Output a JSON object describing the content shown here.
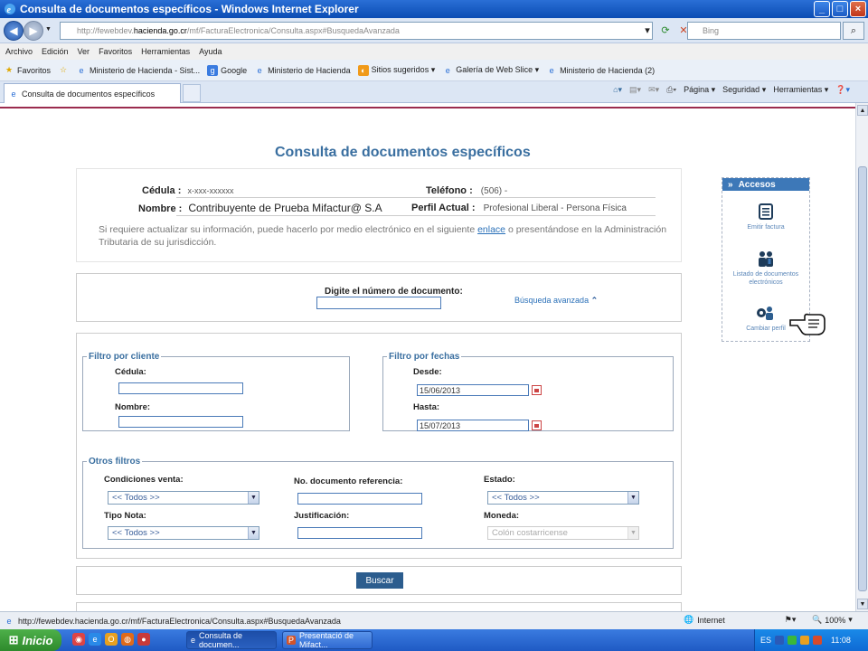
{
  "window": {
    "title": "Consulta de documentos específicos - Windows Internet Explorer"
  },
  "address": {
    "url_prefix": "http://fewebdev.",
    "url_domain": "hacienda.go.cr",
    "url_path": "/mf/FacturaElectronica/Consulta.aspx#BusquedaAvanzada",
    "search_placeholder": "Bing"
  },
  "menu": [
    "Archivo",
    "Edición",
    "Ver",
    "Favoritos",
    "Herramientas",
    "Ayuda"
  ],
  "favorites": {
    "label": "Favoritos",
    "items": [
      "Ministerio de Hacienda - Sist...",
      "Google",
      "Ministerio de Hacienda",
      "Sitios sugeridos ▾",
      "Galería de Web Slice ▾",
      "Ministerio de Hacienda (2)"
    ]
  },
  "tab": {
    "label": "Consulta de documentos específicos"
  },
  "commands": [
    "Página ▾",
    "Seguridad ▾",
    "Herramientas ▾"
  ],
  "page": {
    "title": "Consulta de documentos específicos",
    "info": {
      "cedula_label": "Cédula :",
      "cedula_value": "x-xxx-xxxxxx",
      "telefono_label": "Teléfono :",
      "telefono_value": "(506) -",
      "nombre_label": "Nombre :",
      "nombre_value": "Contribuyente de Prueba Mifactur@ S.A",
      "perfil_label": "Perfil Actual :",
      "perfil_value": "Profesional Liberal - Persona Física",
      "note_before": "Si requiere actualizar su información, puede hacerlo por medio electrónico en el siguiente",
      "note_link": "enlace",
      "note_after": "o presentándose en la Administración Tributaria de su jurisdicción."
    },
    "search": {
      "doc_label": "Digite el número de documento:",
      "adv_link": "Búsqueda avanzada"
    },
    "filtro_cliente": {
      "legend": "Filtro por cliente",
      "cedula_label": "Cédula:",
      "nombre_label": "Nombre:"
    },
    "filtro_fechas": {
      "legend": "Filtro por fechas",
      "desde_label": "Desde:",
      "desde_value": "15/06/2013",
      "hasta_label": "Hasta:",
      "hasta_value": "15/07/2013"
    },
    "otros": {
      "legend": "Otros filtros",
      "condiciones_label": "Condiciones venta:",
      "condiciones_value": "<< Todos >>",
      "referencia_label": "No. documento referencia:",
      "estado_label": "Estado:",
      "estado_value": "<< Todos >>",
      "tipo_label": "Tipo Nota:",
      "tipo_value": "<< Todos >>",
      "justificacion_label": "Justificación:",
      "moneda_label": "Moneda:",
      "moneda_value": "Colón costarricense"
    },
    "buscar_label": "Buscar",
    "accesos": {
      "title": "Accesos",
      "items": [
        "Emitir factura",
        "Listado de documentos electrónicos",
        "Cambiar perfil"
      ]
    }
  },
  "status": {
    "url": "http://fewebdev.hacienda.go.cr/mf/FacturaElectronica/Consulta.aspx#BusquedaAvanzada",
    "zone": "Internet",
    "zoom": "100%"
  },
  "taskbar": {
    "start": "Inicio",
    "tasks": [
      "Consulta de documen...",
      "Presentació de Mifact..."
    ],
    "lang": "ES",
    "time": "11:08"
  },
  "colors": {
    "accent": "#3d78b8",
    "title_text": "#3a6fa0",
    "button": "#2c5d8e",
    "top_line": "#9b2c4e"
  }
}
